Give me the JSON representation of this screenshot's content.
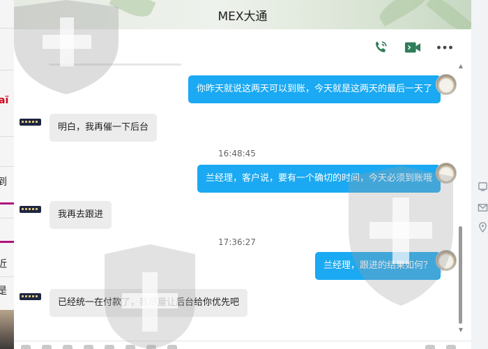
{
  "window": {
    "title": "MEX大通"
  },
  "toolbar": {
    "phone_icon": "phone-icon",
    "video_icon": "video-camera-icon",
    "more_icon": "more-dots-icon"
  },
  "background_page": {
    "fragments": [
      "aï",
      "到",
      "近",
      "是"
    ]
  },
  "messages": [
    {
      "dir": "out",
      "text": "你昨天就说这两天可以到账，今天就是这两天的最后一天了"
    },
    {
      "dir": "in",
      "text": "明白，我再催一下后台"
    },
    {
      "dir": "time",
      "text": "16:48:45"
    },
    {
      "dir": "out",
      "text": "兰经理，客户说，要有一个确切的时间，今天必须到账哦"
    },
    {
      "dir": "in",
      "text": "我再去跟进"
    },
    {
      "dir": "time",
      "text": "17:36:27"
    },
    {
      "dir": "out",
      "text": "兰经理，跟进的结果如何？"
    },
    {
      "dir": "in",
      "text": "已经统一在付款了，我尽量让后台给你优先吧"
    }
  ],
  "colors": {
    "outgoing_bubble": "#1aa9f2",
    "incoming_bubble": "#ececec",
    "accent_icon": "#2f7d5a"
  }
}
